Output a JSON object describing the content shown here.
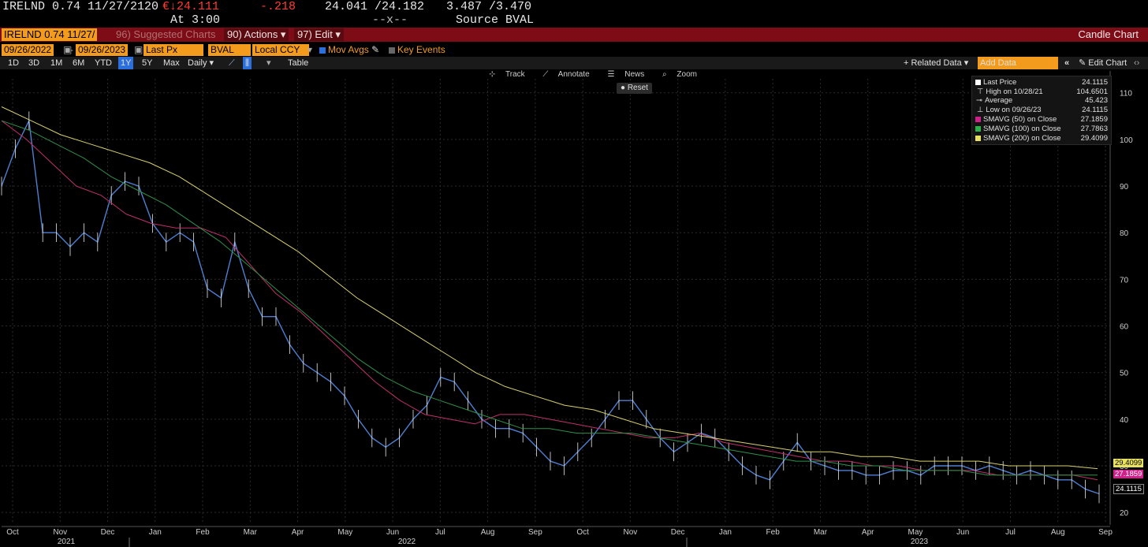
{
  "quote": {
    "ticker": "IRELND 0.74 11/27/2120",
    "price": "€↓24.111",
    "change": "-.218",
    "bid_ask": "24.041 /24.182",
    "yield": "3.487 /3.470",
    "at_time": "At 3:00",
    "size": "--x--",
    "source": "Source BVAL"
  },
  "toolbar": {
    "security": "IRELND 0.74 11/27/",
    "suggested": "96) Suggested Charts",
    "actions": "90) Actions ▾",
    "edit": "97) Edit ▾",
    "chart_type": "Candle Chart"
  },
  "daterow": {
    "start_date": "09/26/2022",
    "end_date": "09/26/2023",
    "field": "Last Px",
    "pricing_source": "BVAL",
    "currency": "Local CCY",
    "mov_avgs": "Mov Avgs",
    "key_events": "Key Events"
  },
  "periods": [
    "1D",
    "3D",
    "1M",
    "6M",
    "YTD",
    "1Y",
    "5Y",
    "Max"
  ],
  "active_period": "1Y",
  "periodrow": {
    "frequency": "Daily ▾",
    "table": "Table",
    "related_data": "+ Related Data ▾",
    "add_data_placeholder": "Add Data",
    "collapse": "«",
    "edit_chart": "✎ Edit Chart",
    "more": "‹›"
  },
  "chart_tools": {
    "track": "Track",
    "annotate": "Annotate",
    "news": "News",
    "zoom": "Zoom",
    "reset": "Reset"
  },
  "legend": {
    "last_price_label": "Last Price",
    "last_price": "24.1115",
    "high_label": "High on 10/28/21",
    "high": "104.6501",
    "average_label": "Average",
    "average": "45.423",
    "low_label": "Low on 09/26/23",
    "low": "24.1115",
    "sma50_label": "SMAVG (50)  on Close",
    "sma50": "27.1859",
    "sma100_label": "SMAVG (100)  on Close",
    "sma100": "27.7863",
    "sma200_label": "SMAVG (200)  on Close",
    "sma200": "29.4099"
  },
  "tags": {
    "sma200": "29.4099",
    "sma50": "27.1859",
    "last": "24.1115"
  },
  "colors": {
    "background": "#000000",
    "toolbar_red": "#7d0c16",
    "amber": "#f29b1d",
    "price_line": "#4f7fd0",
    "sma50": "#c0306a",
    "sma100": "#2f8f4a",
    "sma200": "#d8d070",
    "grid": "#2b2b2b"
  },
  "chart_data": {
    "type": "line",
    "x_months": [
      "Oct",
      "Nov",
      "Dec",
      "Jan",
      "Feb",
      "Mar",
      "Apr",
      "May",
      "Jun",
      "Jul",
      "Aug",
      "Sep",
      "Oct",
      "Nov",
      "Dec",
      "Jan",
      "Feb",
      "Mar",
      "Apr",
      "May",
      "Jun",
      "Jul",
      "Aug",
      "Sep"
    ],
    "x_years": [
      "2021",
      "2022",
      "2023"
    ],
    "y_ticks": [
      20,
      30,
      40,
      50,
      60,
      70,
      80,
      90,
      100,
      110
    ],
    "ylim": [
      18,
      113
    ],
    "series": [
      {
        "name": "Last Price",
        "values": [
          90,
          98,
          104,
          80,
          80,
          77,
          80,
          78,
          88,
          91,
          90,
          82,
          78,
          80,
          78,
          68,
          66,
          78,
          68,
          62,
          62,
          56,
          52,
          50,
          48,
          45,
          40,
          36,
          34,
          36,
          40,
          43,
          49,
          48,
          44,
          40,
          38,
          38,
          37,
          34,
          31,
          30,
          33,
          36,
          40,
          44,
          44,
          40,
          36,
          33,
          35,
          37,
          36,
          33,
          30,
          28,
          27,
          31,
          35,
          31,
          30,
          29,
          29,
          28,
          28,
          29,
          29,
          28,
          30,
          30,
          30,
          29,
          30,
          29,
          28,
          29,
          28,
          27,
          27,
          25,
          24
        ]
      },
      {
        "name": "SMAVG (50) on Close",
        "values": [
          104,
          100,
          95,
          90,
          88,
          84,
          82,
          81,
          81,
          79,
          73,
          67,
          63,
          58,
          53,
          48,
          44,
          41,
          40,
          39,
          41,
          41,
          40,
          39,
          38,
          37,
          36,
          36,
          37,
          35,
          34,
          33,
          32,
          31,
          31,
          30,
          30,
          29,
          29,
          29,
          28,
          28,
          28,
          28,
          27
        ]
      },
      {
        "name": "SMAVG (100) on Close",
        "values": [
          104,
          102,
          99,
          96,
          92,
          89,
          86,
          82,
          78,
          73,
          68,
          63,
          58,
          53,
          49,
          46,
          44,
          42,
          40,
          38,
          38,
          37,
          37,
          37,
          36,
          35,
          34,
          33,
          32,
          31,
          31,
          30,
          30,
          29,
          29,
          29,
          28,
          28,
          28,
          28,
          28
        ]
      },
      {
        "name": "SMAVG (200) on Close",
        "values": [
          107,
          104,
          101,
          99,
          97,
          95,
          92,
          88,
          84,
          80,
          76,
          71,
          66,
          62,
          58,
          54,
          50,
          47,
          45,
          43,
          42,
          40,
          38,
          37,
          36,
          35,
          34,
          33,
          33,
          32,
          32,
          31,
          31,
          31,
          30,
          30,
          30,
          29.4
        ]
      }
    ]
  }
}
